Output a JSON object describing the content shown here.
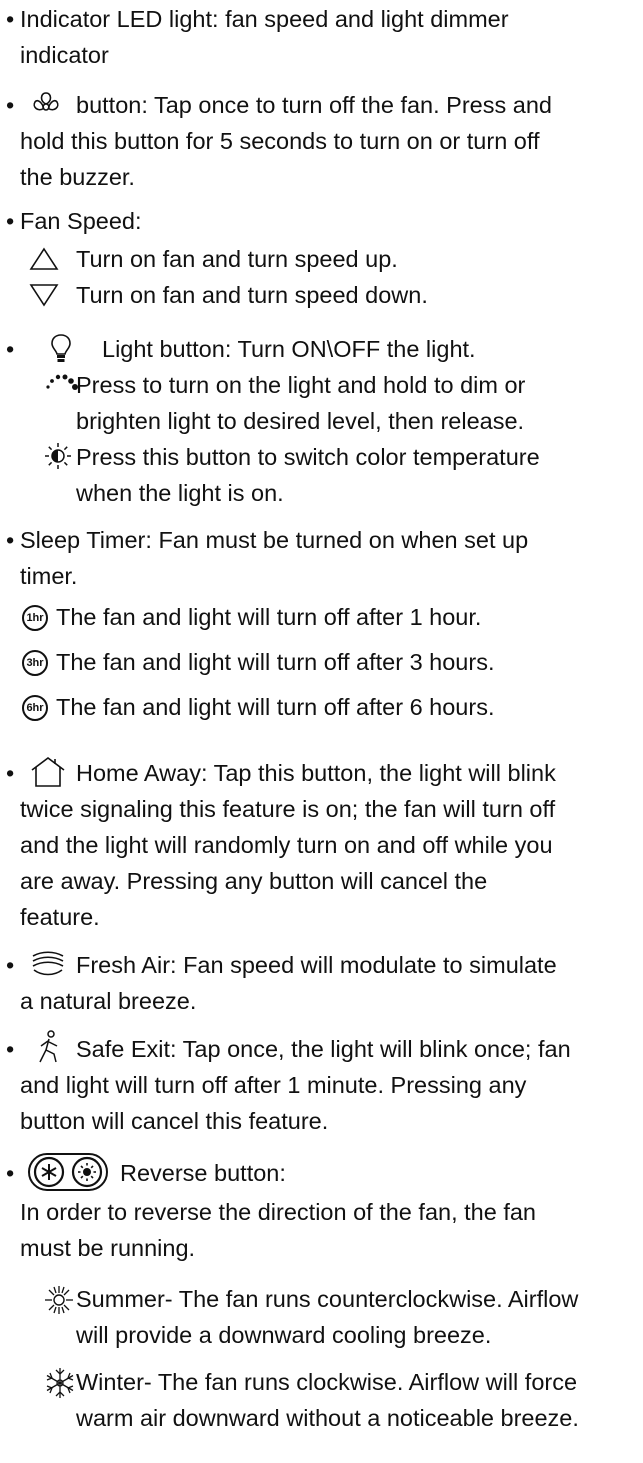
{
  "sections": {
    "indicator": {
      "l1": "Indicator LED light: fan speed and light dimmer",
      "l2": "indicator"
    },
    "power": {
      "l1": "button: Tap once to turn off the fan. Press and",
      "l2": "hold this button for 5 seconds to turn on or turn off",
      "l3": "the buzzer.",
      "icon": "fan-icon"
    },
    "fan_speed": {
      "title": "Fan Speed:",
      "up": "Turn on fan and turn speed up.",
      "down": "Turn on fan and turn speed down.",
      "up_icon": "triangle-up-icon",
      "down_icon": "triangle-down-icon"
    },
    "light": {
      "l1": "Light button: Turn ON\\OFF the light.",
      "dim1": "Press to turn on the light and hold to dim or",
      "dim2": "brighten light to desired level, then release.",
      "temp1": "Press this button to switch color temperature",
      "temp2": "when the light is on.",
      "icon": "light-bulb-icon",
      "dim_icon": "dimmer-icon",
      "temp_icon": "color-temperature-icon"
    },
    "sleep_timer": {
      "l1": "Sleep Timer: Fan must be turned on when set up",
      "l2": "timer.",
      "items": [
        {
          "badge": "1hr",
          "text": "The fan and light will turn off after 1 hour."
        },
        {
          "badge": "3hr",
          "text": "The fan and light will turn off after 3 hours."
        },
        {
          "badge": "6hr",
          "text": "The fan and light will turn off after 6 hours."
        }
      ]
    },
    "home_away": {
      "l1": "Home Away: Tap this button, the light will blink",
      "l2": "twice signaling this feature is on; the fan will turn off",
      "l3": "and the light will randomly turn on and off while you",
      "l4": "are away. Pressing any button will cancel the",
      "l5": "feature.",
      "icon": "home-icon"
    },
    "fresh_air": {
      "l1": "Fresh Air: Fan speed will modulate to simulate",
      "l2": "a natural breeze.",
      "icon": "breeze-icon"
    },
    "safe_exit": {
      "l1": "Safe Exit: Tap once, the light will blink once; fan",
      "l2": "and light will turn off after 1 minute. Pressing any",
      "l3": "button will cancel this feature.",
      "icon": "walking-person-icon"
    },
    "reverse": {
      "title": "Reverse button:",
      "l1": "In order to reverse the direction of the fan, the fan",
      "l2": "must be running.",
      "summer1": "Summer- The fan runs counterclockwise. Airflow",
      "summer2": "will provide a downward cooling breeze.",
      "winter1": "Winter- The fan runs clockwise. Airflow will force",
      "winter2": "warm air downward without a noticeable breeze.",
      "icon": "reverse-button-icon",
      "summer_icon": "summer-sun-icon",
      "winter_icon": "winter-snowflake-icon"
    }
  }
}
